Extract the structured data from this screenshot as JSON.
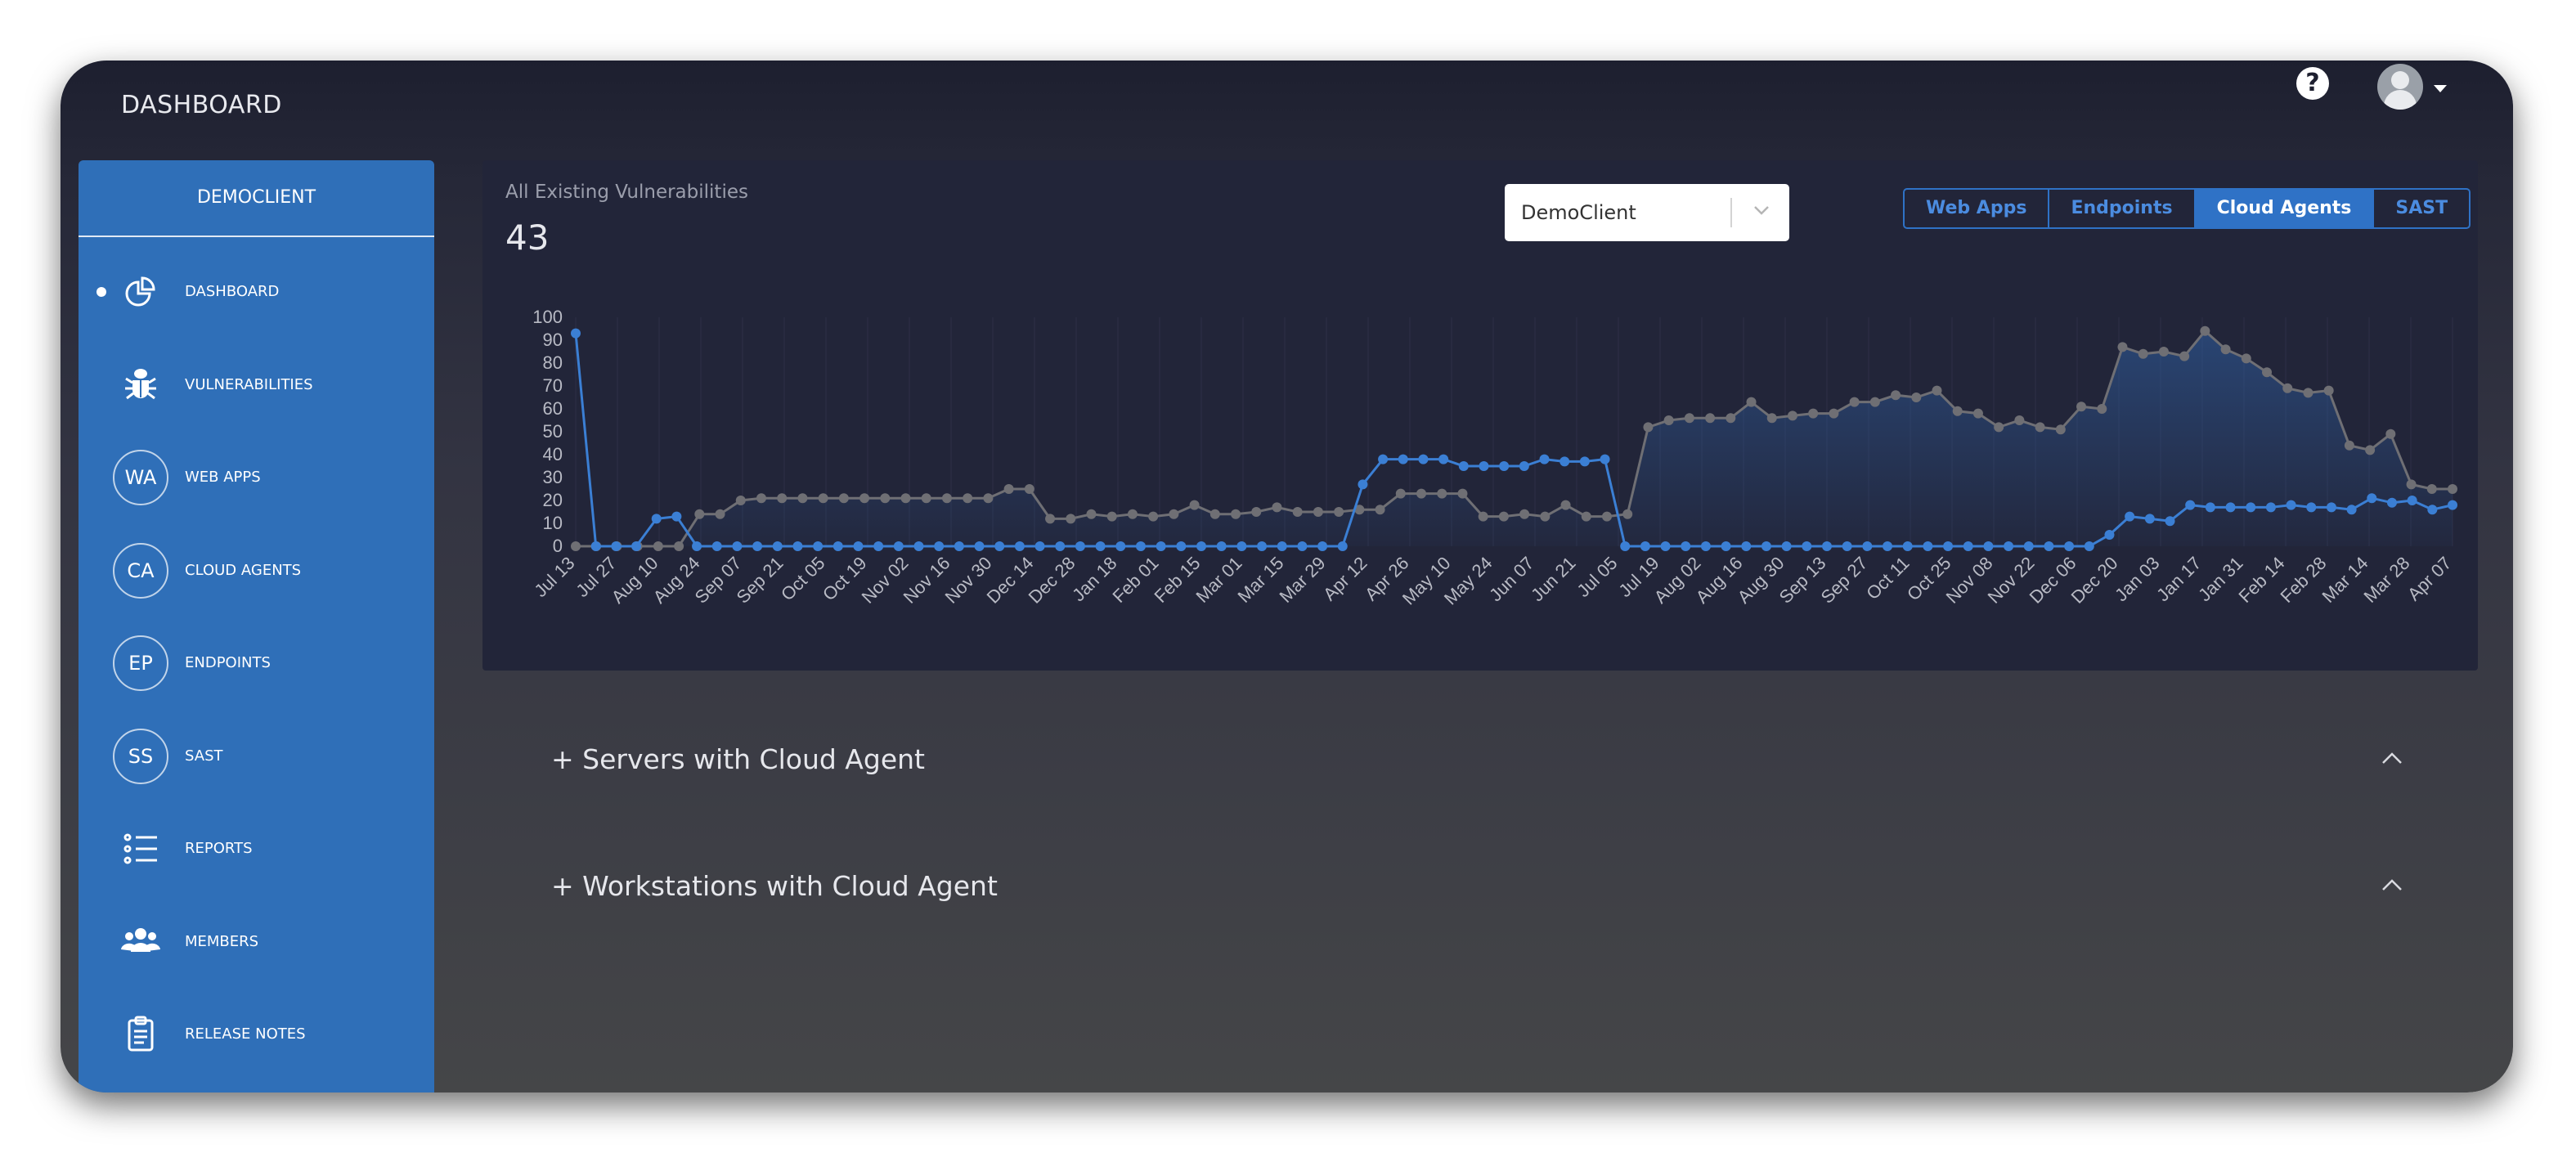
{
  "header": {
    "title": "DASHBOARD",
    "help_icon": "?"
  },
  "sidebar": {
    "org_name": "DEMOCLIENT",
    "items": [
      {
        "label": "DASHBOARD",
        "icon": "pie-chart-icon",
        "active": true
      },
      {
        "label": "VULNERABILITIES",
        "icon": "bug-icon"
      },
      {
        "label": "WEB APPS",
        "badge": "WA"
      },
      {
        "label": "CLOUD AGENTS",
        "badge": "CA"
      },
      {
        "label": "ENDPOINTS",
        "badge": "EP"
      },
      {
        "label": "SAST",
        "badge": "SS"
      },
      {
        "label": "REPORTS",
        "icon": "list-icon"
      },
      {
        "label": "MEMBERS",
        "icon": "users-icon"
      },
      {
        "label": "RELEASE NOTES",
        "icon": "clipboard-icon"
      }
    ]
  },
  "panel": {
    "title": "All Existing Vulnerabilities",
    "count": "43",
    "client_select": {
      "value": "DemoClient"
    },
    "tabs": [
      {
        "label": "Web Apps",
        "active": false
      },
      {
        "label": "Endpoints",
        "active": false
      },
      {
        "label": "Cloud Agents",
        "active": true
      },
      {
        "label": "SAST",
        "active": false
      }
    ]
  },
  "chart_data": {
    "type": "line",
    "title": "",
    "xlabel": "",
    "ylabel": "",
    "ylim": [
      0,
      100
    ],
    "y_ticks": [
      "0",
      "10",
      "20",
      "30",
      "40",
      "50",
      "60",
      "70",
      "80",
      "90",
      "100"
    ],
    "x_tick_labels": [
      "Jul 13",
      "Jul 27",
      "Aug 10",
      "Aug 24",
      "Sep 07",
      "Sep 21",
      "Oct 05",
      "Oct 19",
      "Nov 02",
      "Nov 16",
      "Nov 30",
      "Dec 14",
      "Dec 28",
      "Jan 18",
      "Feb 01",
      "Feb 15",
      "Mar 01",
      "Mar 15",
      "Mar 29",
      "Apr 12",
      "Apr 26",
      "May 10",
      "May 24",
      "Jun 07",
      "Jun 21",
      "Jul 05",
      "Jul 19",
      "Aug 02",
      "Aug 16",
      "Aug 30",
      "Sep 13",
      "Sep 27",
      "Oct 11",
      "Oct 25",
      "Nov 08",
      "Nov 22",
      "Dec 06",
      "Dec 20",
      "Jan 03",
      "Jan 17",
      "Jan 31",
      "Feb 14",
      "Feb 28",
      "Mar 14",
      "Mar 28",
      "Apr 07"
    ],
    "grid": true,
    "colors": {
      "blue_series": "#3b7fd4",
      "gray_series": "#6f6f74"
    },
    "series": [
      {
        "values": [
          93,
          0,
          0,
          0,
          12,
          13,
          0,
          0,
          0,
          0,
          0,
          0,
          0,
          0,
          0,
          0,
          0,
          0,
          0,
          0,
          0,
          0,
          0,
          0,
          0,
          0,
          0,
          0,
          0,
          0,
          0,
          0,
          0,
          0,
          0,
          0,
          0,
          0,
          0,
          27,
          38,
          38,
          38,
          38,
          35,
          35,
          35,
          35,
          38,
          37,
          37,
          38,
          0,
          0,
          0,
          0,
          0,
          0,
          0,
          0,
          0,
          0,
          0,
          0,
          0,
          0,
          0,
          0,
          0,
          0,
          0,
          0,
          0,
          0,
          0,
          0,
          5,
          13,
          12,
          11,
          18,
          17,
          17,
          17,
          17,
          18,
          17,
          17,
          16,
          21,
          19,
          20,
          16,
          18
        ]
      },
      {
        "values": [
          0,
          0,
          0,
          0,
          0,
          0,
          14,
          14,
          20,
          21,
          21,
          21,
          21,
          21,
          21,
          21,
          21,
          21,
          21,
          21,
          21,
          25,
          25,
          12,
          12,
          14,
          13,
          14,
          13,
          14,
          18,
          14,
          14,
          15,
          17,
          15,
          15,
          15,
          16,
          16,
          23,
          23,
          23,
          23,
          13,
          13,
          14,
          13,
          18,
          13,
          13,
          14,
          52,
          55,
          56,
          56,
          56,
          63,
          56,
          57,
          58,
          58,
          63,
          63,
          66,
          65,
          68,
          59,
          58,
          52,
          55,
          52,
          51,
          61,
          60,
          87,
          84,
          85,
          83,
          94,
          86,
          82,
          76,
          69,
          67,
          68,
          44,
          42,
          49,
          27,
          25,
          25
        ]
      }
    ]
  },
  "sections": [
    {
      "title": "+ Servers with Cloud Agent"
    },
    {
      "title": "+ Workstations with Cloud Agent"
    }
  ]
}
